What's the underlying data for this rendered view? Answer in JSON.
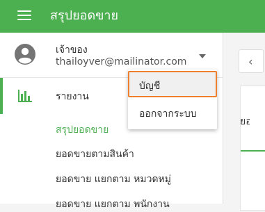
{
  "topbar": {
    "title": "สรุปยอดขาย"
  },
  "account": {
    "owner_label": "เจ้าของ",
    "email": "thailoyver@mailinator.com"
  },
  "nav": {
    "reports_label": "รายงาน",
    "subitems": [
      {
        "label": "สรุปยอดขาย",
        "active": true
      },
      {
        "label": "ยอดขายตามสินค้า"
      },
      {
        "label": "ยอดขาย แยกตาม หมวดหมู่"
      },
      {
        "label": "ยอดขาย แยกตาม พนักงาน"
      }
    ]
  },
  "dropdown": {
    "items": [
      {
        "label": "บัญชี"
      },
      {
        "label": "ออกจากระบบ"
      }
    ]
  },
  "right_panel": {
    "back_glyph": "‹",
    "card_text": "ยอ"
  },
  "colors": {
    "brand_green": "#4caf50",
    "focus_orange": "#ef7f2d"
  }
}
